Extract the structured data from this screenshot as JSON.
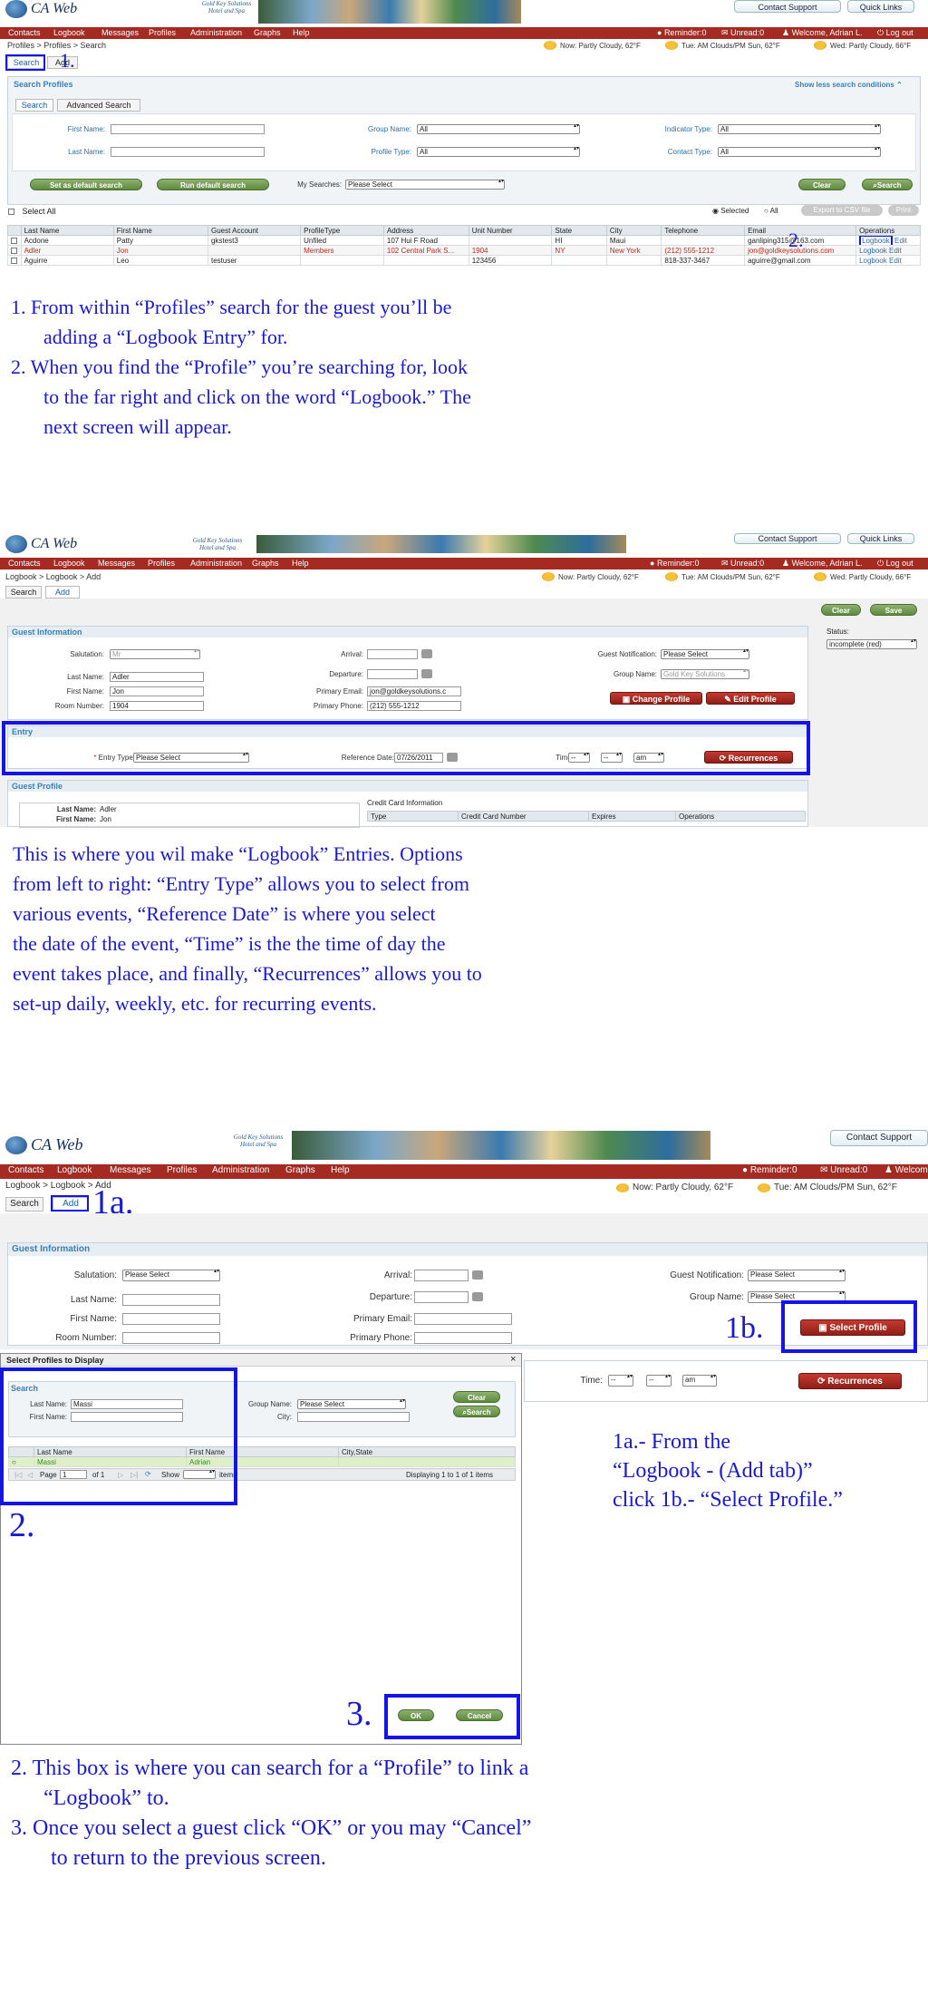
{
  "header": {
    "app_title": "CA Web",
    "crest_text": "Gold Key Solutions Hotel and Spa",
    "contact_support": "Contact Support",
    "quick_links": "Quick Links"
  },
  "menu": {
    "items": [
      "Contacts",
      "Logbook",
      "Messages",
      "Profiles",
      "Administration",
      "Graphs",
      "Help"
    ],
    "reminder": "Reminder:0",
    "unread": "Unread:0",
    "welcome": "Welcome, Adrian L.",
    "welcome_cut": "Welcom",
    "logout": "Log out"
  },
  "weather": {
    "now": "Now: Partly Cloudy, 62°F",
    "tue": "Tue: AM Clouds/PM Sun, 62°F",
    "wed": "Wed: Partly Cloudy, 66°F"
  },
  "s1": {
    "breadcrumb": "Profiles > Profiles > Search",
    "tab_search": "Search",
    "tab_add": "Add",
    "panel_title": "Search Profiles",
    "less_conditions": "Show less search conditions",
    "subtab_search": "Search",
    "subtab_advanced": "Advanced Search",
    "first_name": "First Name:",
    "last_name": "Last Name:",
    "group_name": "Group Name:",
    "profile_type": "Profile Type:",
    "indicator_type": "Indicator Type:",
    "contact_type": "Contact Type:",
    "all": "All",
    "set_default": "Set as default search",
    "run_default": "Run default search",
    "my_searches": "My Searches:",
    "please_select": "Please Select",
    "clear": "Clear",
    "search": "Search",
    "select_all": "Select All",
    "selected": "Selected",
    "all_radio": "All",
    "export_csv": "Export to CSV file",
    "print": "Print",
    "columns": [
      "Last Name",
      "First Name",
      "Guest Account",
      "ProfileType",
      "Address",
      "Unit Number",
      "State",
      "City",
      "Telephone",
      "Email",
      "Operations"
    ],
    "rows": [
      [
        "Acdone",
        "Patty",
        "gkstest3",
        "Unfiled",
        "107 Hui F Road",
        "",
        "HI",
        "Maui",
        "",
        "ganliping315@163.com",
        "Logbook",
        "Edit"
      ],
      [
        "Adler",
        "Jon",
        "",
        "Members",
        "102 Central Park S...",
        "1904",
        "NY",
        "New York",
        "(212) 555-1212",
        "jon@goldkeysolutions.com",
        "Logbook",
        "Edit"
      ],
      [
        "Aguirre",
        "Leo",
        "testuser",
        "",
        "",
        "123456",
        "",
        "",
        "818-337-3467",
        "aguirre@gmail.com",
        "Logbook",
        "Edit"
      ]
    ],
    "marker1": "1.",
    "marker2": "2."
  },
  "note1": {
    "line1": "1. From within “Profiles” search for the guest you’ll be",
    "line2": "adding a “Logbook Entry” for.",
    "line3": "2.  When you find the “Profile” you’re searching for, look",
    "line4": "to the far right and click on the word  “Logbook.”  The",
    "line5": "next screen will appear."
  },
  "s2": {
    "breadcrumb": "Logbook > Logbook > Add",
    "tab_search": "Search",
    "tab_add": "Add",
    "clear": "Clear",
    "save": "Save",
    "status_label": "Status:",
    "status_value": "incomplete (red)",
    "guest_info": "Guest Information",
    "salutation": "Salutation:",
    "salutation_value": "Mr",
    "last_name": "Last Name:",
    "last_name_value": "Adler",
    "first_name": "First Name:",
    "first_name_value": "Jon",
    "room_number": "Room Number:",
    "room_value": "1904",
    "arrival": "Arrival:",
    "departure": "Departure:",
    "primary_email": "Primary Email:",
    "email_value": "jon@goldkeysolutions.c",
    "primary_phone": "Primary Phone:",
    "phone_value": "(212) 555-1212",
    "guest_notification": "Guest Notification:",
    "please_select": "Please Select",
    "group_name": "Group Name:",
    "group_value": "Gold Key Solutions",
    "change_profile": "Change Profile",
    "edit_profile": "Edit Profile",
    "entry": "Entry",
    "entry_type": "Entry Type:",
    "reference_date": "Reference Date:",
    "date_value": "07/26/2011",
    "time": "Time:",
    "dash": "--",
    "ampm": "am",
    "recurrences": "Recurrences",
    "guest_profile": "Guest Profile",
    "gp_last": "Last Name:",
    "gp_last_value": "Adler",
    "gp_first": "First Name:",
    "gp_first_value": "Jon",
    "cc_info": "Credit Card Information",
    "cc_cols": [
      "Type",
      "Credit Card Number",
      "Expires",
      "Operations"
    ]
  },
  "note2": {
    "line1": "This is where you wil make “Logbook” Entries. Options",
    "line2": "from left to right: “Entry Type” allows you to select from",
    "line3": "various events, “Reference Date” is where you select",
    "line4": "the date of the event, “Time” is the the time of day the",
    "line5": "event takes place, and finally, “Recurrences” allows you to",
    "line6": "set-up daily, weekly, etc. for recurring events."
  },
  "s3": {
    "breadcrumb": "Logbook > Logbook > Add",
    "tab_search": "Search",
    "tab_add": "Add",
    "marker_1a": "1a.",
    "marker_1b": "1b.",
    "marker_2": "2.",
    "marker_3": "3.",
    "guest_info": "Guest Information",
    "salutation": "Salutation:",
    "please_select": "Please Select",
    "last_name": "Last Name:",
    "first_name": "First Name:",
    "room_number": "Room Number:",
    "arrival": "Arrival:",
    "departure": "Departure:",
    "primary_email": "Primary Email:",
    "primary_phone": "Primary Phone:",
    "guest_notification": "Guest Notification:",
    "group_name": "Group Name:",
    "select_profile": "Select Profile",
    "time": "Time:",
    "dash": "--",
    "ampm": "am",
    "recurrences": "Recurrences",
    "dialog_title": "Select Profiles to Display",
    "dialog_close": "×",
    "search_section": "Search",
    "d_last_name": "Last Name:",
    "d_last_value": "Massi",
    "d_first_name": "First Name:",
    "d_group_name": "Group Name:",
    "d_city": "City:",
    "clear": "Clear",
    "search": "Search",
    "d_cols": [
      "Last Name",
      "First Name",
      "City,State"
    ],
    "d_row": [
      "Massi",
      "Adrian",
      ""
    ],
    "page": "Page",
    "page_value": "1",
    "of_pages": "of 1",
    "show": "Show",
    "items": "items",
    "displaying": "Displaying 1 to 1 of 1 items",
    "ok": "OK",
    "cancel": "Cancel"
  },
  "note3": {
    "line1": "1a.- From the",
    "line2": "“Logbook - (Add tab)”",
    "line3": "click 1b.- “Select Profile.”"
  },
  "note4": {
    "line1": "2. This box is where you can search for a “Profile” to link a",
    "line2": "“Logbook” to.",
    "line3": "3. Once you select a guest click “OK” or you may “Cancel”",
    "line4": "to return to the previous screen."
  }
}
